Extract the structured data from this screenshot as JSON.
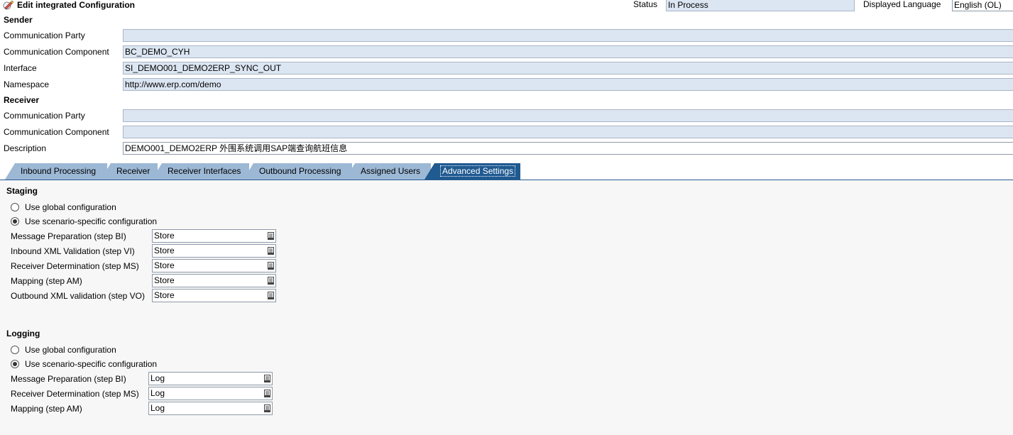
{
  "header": {
    "title": "Edit integrated Configuration",
    "status_label": "Status",
    "status_value": "In Process",
    "language_label": "Displayed Language",
    "language_value": "English (OL)"
  },
  "sender": {
    "heading": "Sender",
    "party_label": "Communication Party",
    "party_value": "",
    "component_label": "Communication Component",
    "component_value": "BC_DEMO_CYH",
    "interface_label": "Interface",
    "interface_value": "SI_DEMO001_DEMO2ERP_SYNC_OUT",
    "namespace_label": "Namespace",
    "namespace_value": "http://www.erp.com/demo"
  },
  "receiver": {
    "heading": "Receiver",
    "party_label": "Communication Party",
    "party_value": "",
    "component_label": "Communication Component",
    "component_value": ""
  },
  "description": {
    "label": "Description",
    "value": "DEMO001_DEMO2ERP 外围系统调用SAP端查询航班信息"
  },
  "tabs": [
    {
      "label": "Inbound Processing"
    },
    {
      "label": "Receiver"
    },
    {
      "label": "Receiver Interfaces"
    },
    {
      "label": "Outbound Processing"
    },
    {
      "label": "Assigned Users"
    },
    {
      "label": "Advanced Settings"
    }
  ],
  "staging": {
    "heading": "Staging",
    "radio_global": "Use global configuration",
    "radio_specific": "Use scenario-specific configuration",
    "selected": "specific",
    "rows": [
      {
        "label": "Message Preparation (step BI)",
        "value": "Store"
      },
      {
        "label": "Inbound XML Validation (step VI)",
        "value": "Store"
      },
      {
        "label": "Receiver Determination (step MS)",
        "value": "Store"
      },
      {
        "label": "Mapping (step AM)",
        "value": "Store"
      },
      {
        "label": "Outbound XML validation (step VO)",
        "value": "Store"
      }
    ]
  },
  "logging": {
    "heading": "Logging",
    "radio_global": "Use global configuration",
    "radio_specific": "Use scenario-specific configuration",
    "selected": "specific",
    "rows": [
      {
        "label": "Message Preparation (step BI)",
        "value": "Log"
      },
      {
        "label": "Receiver Determination (step MS)",
        "value": "Log"
      },
      {
        "label": "Mapping (step AM)",
        "value": "Log"
      }
    ]
  }
}
